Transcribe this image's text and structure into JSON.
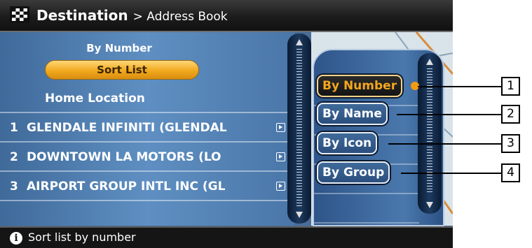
{
  "header": {
    "title": "Destination",
    "breadcrumb": "> Address Book"
  },
  "list": {
    "sort_caption": "By Number",
    "sort_button": "Sort List",
    "home": "Home Location",
    "entries": [
      {
        "num": "1",
        "name": "GLENDALE INFINITI (GLENDAL"
      },
      {
        "num": "2",
        "name": "DOWNTOWN LA MOTORS (LO"
      },
      {
        "num": "3",
        "name": "AIRPORT GROUP INTL INC (GL"
      }
    ]
  },
  "sort_menu": {
    "options": [
      "By Number",
      "By Name",
      "By Icon",
      "By Group"
    ],
    "selected": "By Number"
  },
  "footer": {
    "text": "Sort list by number"
  },
  "callouts": [
    "1",
    "2",
    "3",
    "4"
  ],
  "colors": {
    "accent": "#f3a71e",
    "panel": "#4a78ad",
    "header": "#1c1c1c"
  },
  "icons": {
    "header": "checkered-flag-icon",
    "footer": "info-icon",
    "entry": "arrow-right-icon"
  }
}
